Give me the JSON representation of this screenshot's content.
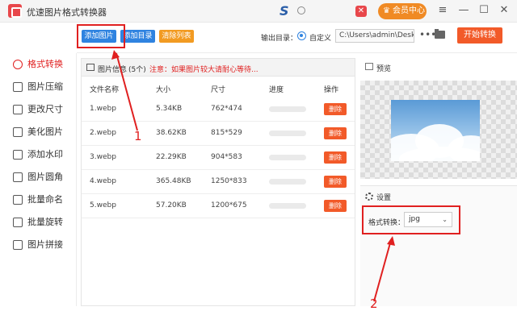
{
  "window": {
    "title": "优速图片格式转换器",
    "vip_label": "会员中心",
    "vip_icon": "crown-icon",
    "close_red_icon": "red-x-icon",
    "brand_mark": "S",
    "controls": {
      "menu": "≡",
      "minimize": "—",
      "maximize": "☐",
      "close": "✕"
    }
  },
  "toolbar": {
    "add_image": "添加图片",
    "add_dir": "添加目录",
    "clear_list": "清除列表",
    "output_label": "输出目录：",
    "custom_label": "自定义",
    "output_path": "C:\\Users\\admin\\Deskto",
    "browse_dots": "•••",
    "start_btn": "开始转换"
  },
  "sidebar": {
    "items": [
      {
        "label": "格式转换",
        "active": true
      },
      {
        "label": "图片压缩"
      },
      {
        "label": "更改尺寸"
      },
      {
        "label": "美化图片"
      },
      {
        "label": "添加水印"
      },
      {
        "label": "图片圆角"
      },
      {
        "label": "批量命名"
      },
      {
        "label": "批量旋转"
      },
      {
        "label": "图片拼接"
      }
    ]
  },
  "filelist": {
    "title": "图片信息",
    "count": "(5个)",
    "note": "注意：如果图片较大请耐心等待...",
    "columns": [
      "文件名称",
      "大小",
      "尺寸",
      "进度",
      "操作"
    ],
    "rows": [
      {
        "name": "1.webp",
        "size": "5.34KB",
        "dim": "762*474",
        "progress": 0,
        "action": "删除"
      },
      {
        "name": "2.webp",
        "size": "38.62KB",
        "dim": "815*529",
        "progress": 0,
        "action": "删除"
      },
      {
        "name": "3.webp",
        "size": "22.29KB",
        "dim": "904*583",
        "progress": 0,
        "action": "删除"
      },
      {
        "name": "4.webp",
        "size": "365.48KB",
        "dim": "1250*833",
        "progress": 0,
        "action": "删除"
      },
      {
        "name": "5.webp",
        "size": "57.20KB",
        "dim": "1200*675",
        "progress": 0,
        "action": "删除"
      }
    ]
  },
  "preview": {
    "title": "预览"
  },
  "settings": {
    "title": "设置",
    "format_label": "格式转换：",
    "format_value": "jpg",
    "chevron": "⌄"
  },
  "annotations": {
    "num1": "1",
    "num2": "2"
  },
  "colors": {
    "accent_blue": "#2f83e0",
    "accent_orange": "#f25a29",
    "clear_orange": "#f29b22",
    "annotation_red": "#e02020"
  }
}
